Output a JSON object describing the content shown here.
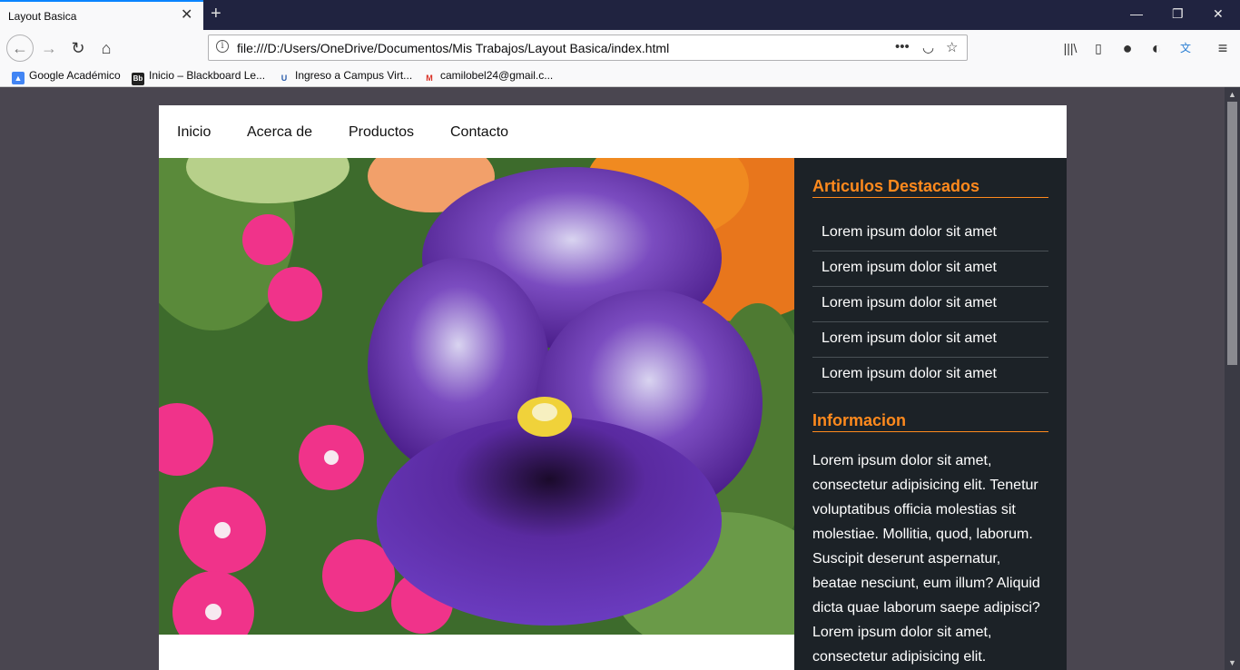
{
  "browser": {
    "tab_title": "Layout Basica",
    "url": "file:///D:/Users/OneDrive/Documentos/Mis Trabajos/Layout Basica/index.html",
    "bookmarks": [
      {
        "label": "Google Académico",
        "icon": "graduation-cap-icon",
        "color": "#4285f4"
      },
      {
        "label": "Inicio – Blackboard Le...",
        "icon": "blackboard-icon",
        "color": "#222222"
      },
      {
        "label": "Ingreso a Campus Virt...",
        "icon": "campus-icon",
        "color": "#2a5caa"
      },
      {
        "label": "camilobel24@gmail.c...",
        "icon": "gmail-icon",
        "color": "#d93025"
      }
    ]
  },
  "site": {
    "nav": [
      "Inicio",
      "Acerca de",
      "Productos",
      "Contacto"
    ],
    "sidebar": {
      "featured_title": "Articulos Destacados",
      "featured_items": [
        "Lorem ipsum dolor sit amet",
        "Lorem ipsum dolor sit amet",
        "Lorem ipsum dolor sit amet",
        "Lorem ipsum dolor sit amet",
        "Lorem ipsum dolor sit amet"
      ],
      "info_title": "Informacion",
      "info_text": "Lorem ipsum dolor sit amet, consectetur adipisicing elit. Tenetur voluptatibus officia molestias sit molestiae. Mollitia, quod, laborum. Suscipit deserunt aspernatur, beatae nesciunt, eum illum? Aliquid dicta quae laborum saepe adipisci? Lorem ipsum dolor sit amet, consectetur adipisicing elit."
    }
  },
  "colors": {
    "accent": "#ff8a1d",
    "sidebar_bg": "#1c2227",
    "page_bg": "#4a4650",
    "tab_accent": "#0a84ff"
  }
}
